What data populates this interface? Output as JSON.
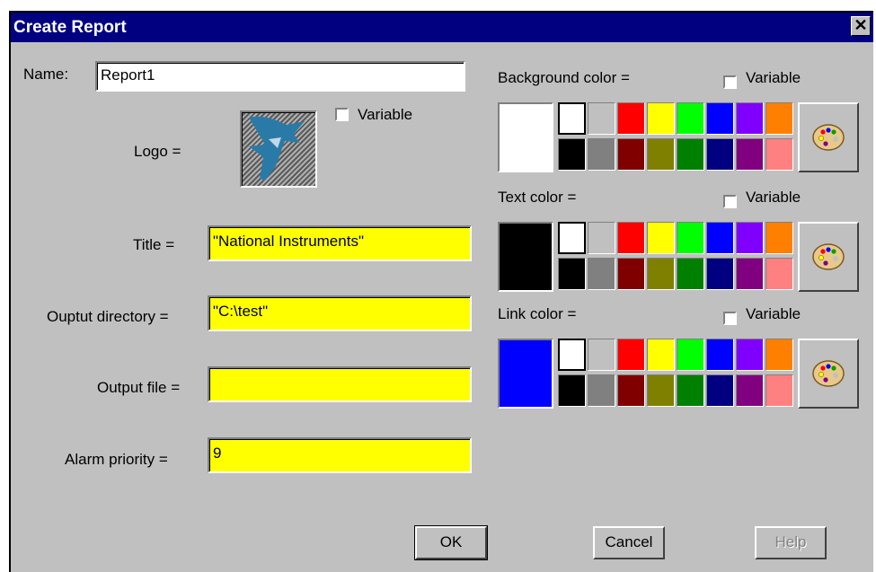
{
  "window": {
    "title": "Create Report",
    "close_glyph": "✕"
  },
  "name": {
    "label": "Name:",
    "value": "Report1"
  },
  "logo": {
    "label": "Logo =",
    "variable_label": "Variable",
    "icon": "national-instruments-eagle-icon"
  },
  "fields": [
    {
      "label": "Title =",
      "value": "\"National Instruments\""
    },
    {
      "label": "Ouptut directory =",
      "value": "\"C:\\test\""
    },
    {
      "label": "Output file =",
      "value": ""
    },
    {
      "label": "Alarm priority =",
      "value": "9"
    }
  ],
  "color_groups": [
    {
      "label": "Background color =",
      "variable_label": "Variable",
      "current": "#ffffff",
      "selected": "#ffffff"
    },
    {
      "label": "Text color =",
      "variable_label": "Variable",
      "current": "#000000",
      "selected": "#ffffff"
    },
    {
      "label": "Link color =",
      "variable_label": "Variable",
      "current": "#0000ff",
      "selected": "#ffffff"
    }
  ],
  "palette_top": [
    "#ffffff",
    "#c0c0c0",
    "#ff0000",
    "#ffff00",
    "#00ff00",
    "#0000ff",
    "#8000ff",
    "#ff8000"
  ],
  "palette_bottom": [
    "#000000",
    "#808080",
    "#800000",
    "#808000",
    "#008000",
    "#000080",
    "#800080",
    "#ff8080"
  ],
  "buttons": {
    "ok": "OK",
    "cancel": "Cancel",
    "help": "Help"
  },
  "colors": {
    "titlebar": "#000080",
    "field_bg": "#ffff00",
    "face": "#c0c0c0"
  }
}
